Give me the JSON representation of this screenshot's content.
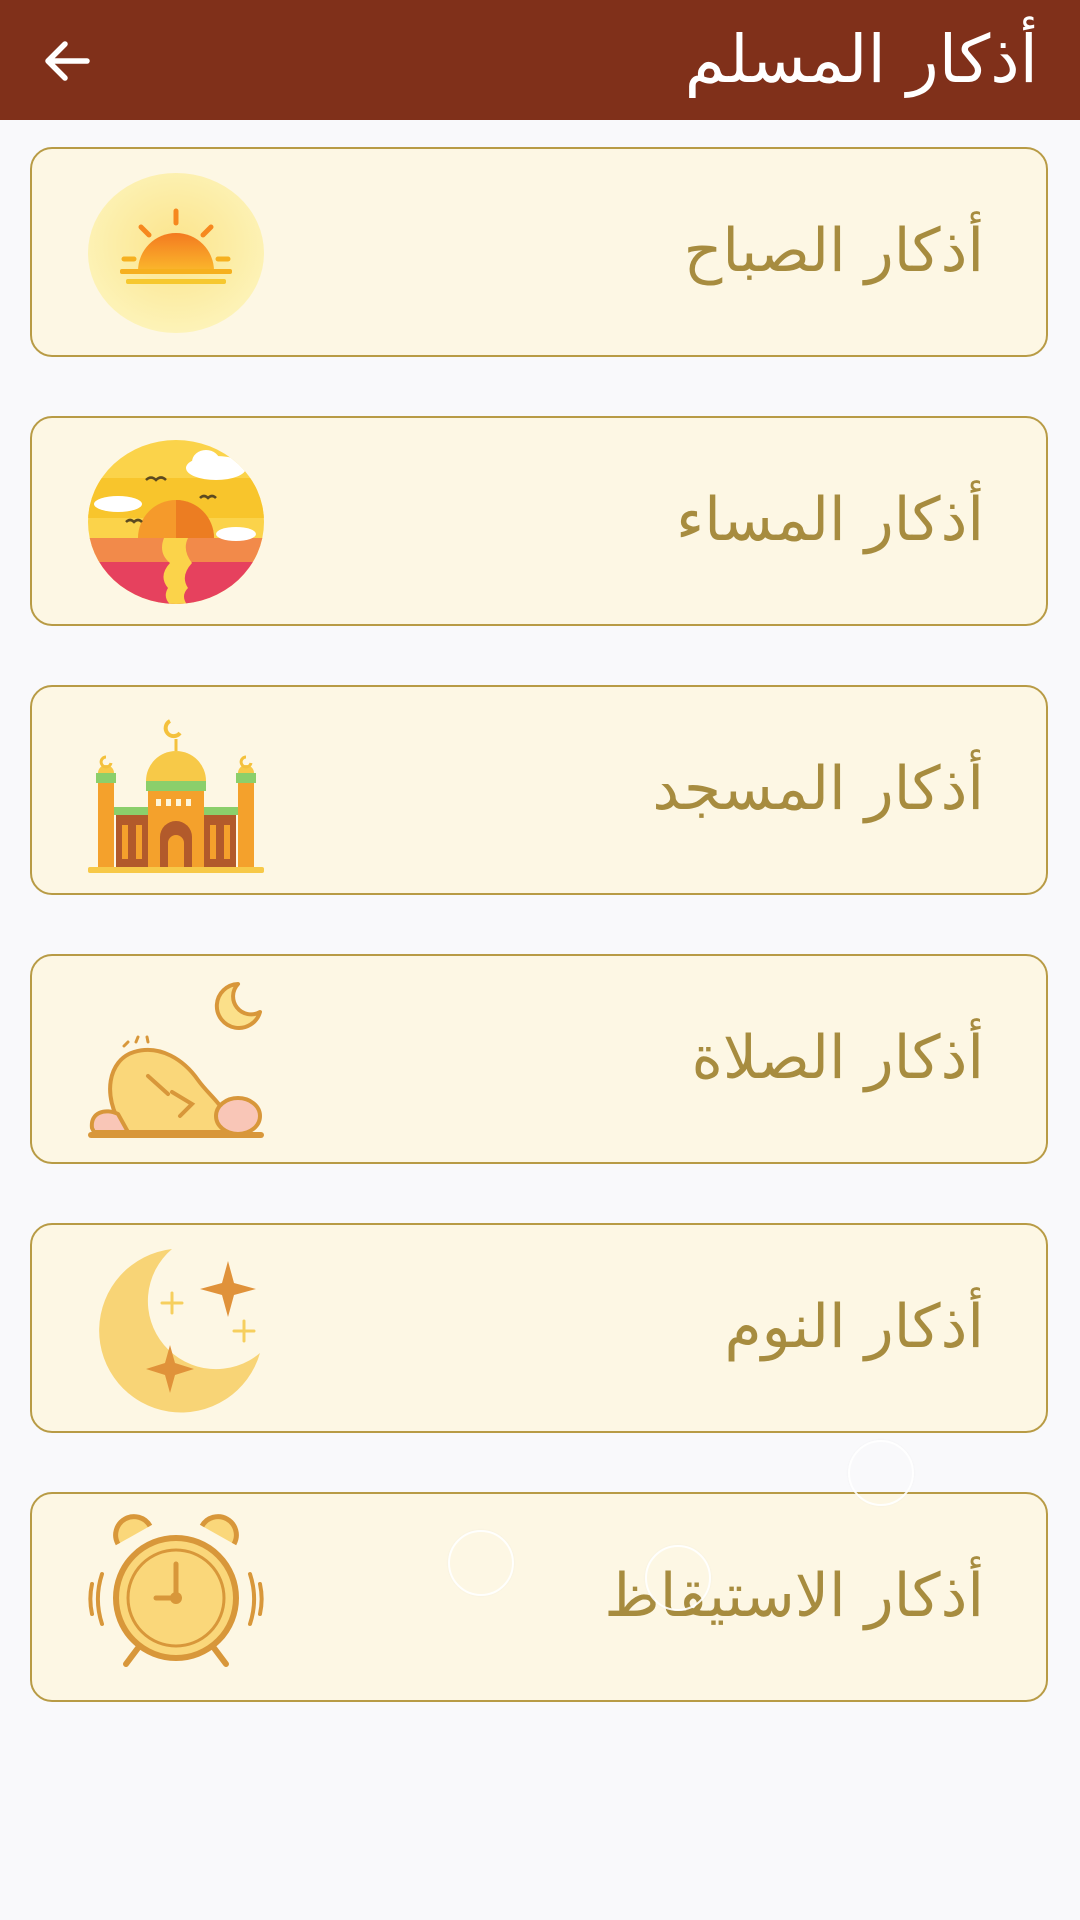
{
  "header": {
    "title": "أذكار المسلم",
    "back_icon": "arrow-back-icon"
  },
  "colors": {
    "appbar": "#80301a",
    "card_bg": "#fdf7e4",
    "card_border": "#b89b45",
    "label": "#a78c3f",
    "page_bg": "#f9f9fb"
  },
  "items": [
    {
      "label": "أذكار الصباح",
      "icon": "sunrise-icon"
    },
    {
      "label": "أذكار المساء",
      "icon": "sunset-icon"
    },
    {
      "label": "أذكار المسجد",
      "icon": "mosque-icon"
    },
    {
      "label": "أذكار الصلاة",
      "icon": "prayer-icon"
    },
    {
      "label": "أذكار النوم",
      "icon": "moon-stars-icon"
    },
    {
      "label": "أذكار الاستيقاظ",
      "icon": "alarm-clock-icon"
    }
  ]
}
